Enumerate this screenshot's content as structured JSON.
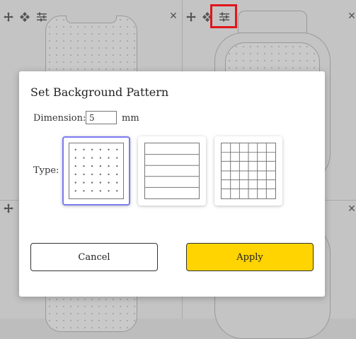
{
  "modal": {
    "title": "Set Background Pattern",
    "dimension_label": "Dimension:",
    "dimension_value": "5",
    "dimension_unit": "mm",
    "type_label": "Type:",
    "patterns": [
      {
        "name": "dots",
        "selected": true
      },
      {
        "name": "lines",
        "selected": false
      },
      {
        "name": "grid",
        "selected": false
      }
    ],
    "cancel_label": "Cancel",
    "apply_label": "Apply"
  },
  "colors": {
    "apply_button": "#ffd400",
    "selected_border": "#7b7bf0",
    "highlight": "#e0161b"
  },
  "icons": [
    "move-icon",
    "pan-icon",
    "settings-sliders-icon",
    "close-icon"
  ]
}
